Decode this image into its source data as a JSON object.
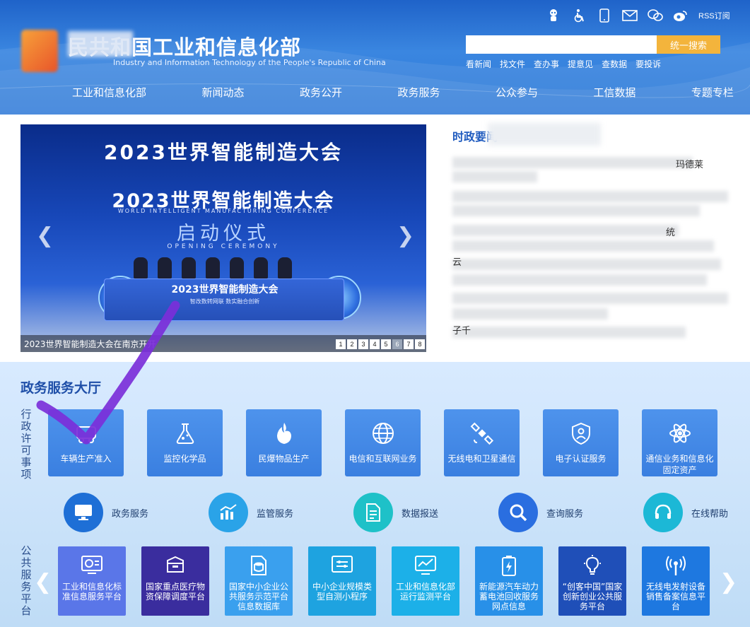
{
  "header": {
    "title": "民共和国工业和信息化部",
    "subtitle": "Industry and Information Technology of the People's Republic of China",
    "top_icons": [
      "robot-icon",
      "accessibility-icon",
      "mobile-icon",
      "mail-icon",
      "wechat-icon",
      "weibo-icon"
    ],
    "rss_label": "RSS订阅",
    "search": {
      "placeholder": "",
      "button_label": "统一搜索"
    },
    "quick_links": [
      "看新闻",
      "找文件",
      "查办事",
      "提意见",
      "查数据",
      "要投诉"
    ],
    "nav": [
      "工业和信息化部",
      "新闻动态",
      "政务公开",
      "政务服务",
      "公众参与",
      "工信数据",
      "专题专栏"
    ]
  },
  "carousel": {
    "banner_title": "2023世界智能制造大会",
    "stage_title": "2023世界智能制造大会",
    "stage_subtitle": "WORLD INTELLIGENT MANUFACTURING CONFERENCE",
    "ceremony": "启动仪式",
    "ceremony_en": "OPENING CEREMONY",
    "podium_title": "2023世界智能制造大会",
    "podium_sub": "智改数转网联  数实融合创新",
    "caption": "2023世界智能制造大会在南京开开",
    "pages": [
      "1",
      "2",
      "3",
      "4",
      "5",
      "6",
      "7",
      "8"
    ],
    "active_page": 6
  },
  "news": {
    "title": "时政要闻",
    "fragments": [
      "玛德莱",
      "统",
      "云",
      "子千"
    ]
  },
  "hall": {
    "title": "政务服务大厅",
    "admin_label": "行政许可事项",
    "public_label": "公共服务平台",
    "admin_tiles": [
      {
        "label": "车辆生产准入",
        "icon": "vehicle-icon"
      },
      {
        "label": "监控化学品",
        "icon": "flask-icon"
      },
      {
        "label": "民爆物品生产",
        "icon": "explosion-icon"
      },
      {
        "label": "电信和互联网业务",
        "icon": "globe-icon"
      },
      {
        "label": "无线电和卫星通信",
        "icon": "satellite-icon"
      },
      {
        "label": "电子认证服务",
        "icon": "shield-icon"
      },
      {
        "label": "通信业务和信息化固定资产",
        "icon": "atom-icon"
      }
    ],
    "service_circles": [
      {
        "label": "政务服务",
        "icon": "monitor-icon",
        "color": "#1e6fd6"
      },
      {
        "label": "监管服务",
        "icon": "chart-icon",
        "color": "#2aa3e8"
      },
      {
        "label": "数据报送",
        "icon": "document-icon",
        "color": "#1ec1c8"
      },
      {
        "label": "查询服务",
        "icon": "search-icon",
        "color": "#2a6ee0"
      },
      {
        "label": "在线帮助",
        "icon": "headset-icon",
        "color": "#1cb8d6"
      }
    ],
    "public_tiles": [
      {
        "label": "工业和信息化标准信息服务平台",
        "icon": "standard-icon",
        "color": "#5a76e8"
      },
      {
        "label": "国家重点医疗物资保障调度平台",
        "icon": "box-icon",
        "color": "#3a2d9e"
      },
      {
        "label": "国家中小企业公共服务示范平台信息数据库",
        "icon": "database-icon",
        "color": "#3aa0ee"
      },
      {
        "label": "中小企业规模类型自测小程序",
        "icon": "sliders-icon",
        "color": "#1ea3e0"
      },
      {
        "label": "工业和信息化部运行监测平台",
        "icon": "monitor-chart-icon",
        "color": "#1cb0e8"
      },
      {
        "label": "新能源汽车动力蓄电池回收服务网点信息",
        "icon": "battery-icon",
        "color": "#2890e8"
      },
      {
        "label": "“创客中国”国家创新创业公共服务平台",
        "icon": "bulb-icon",
        "color": "#1f4fb8"
      },
      {
        "label": "无线电发射设备销售备案信息平台",
        "icon": "antenna-icon",
        "color": "#1e78e0"
      }
    ]
  }
}
